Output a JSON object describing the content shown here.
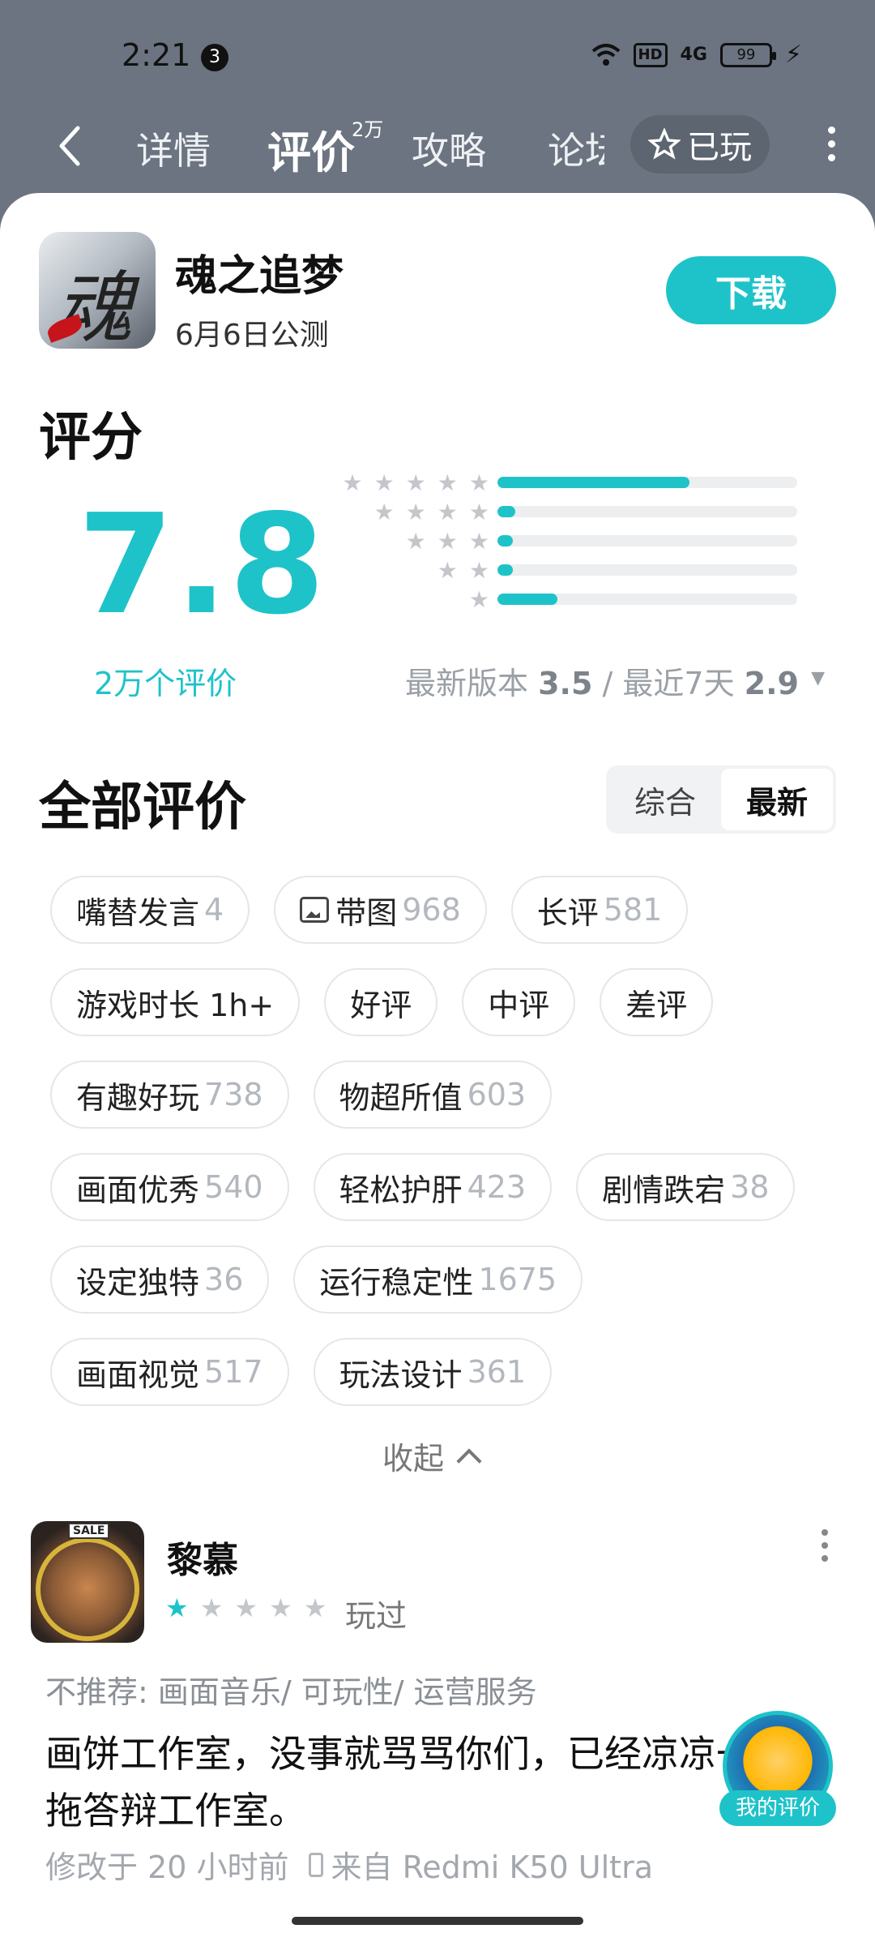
{
  "status_bar": {
    "time": "2:21",
    "notification_count": "3",
    "hd": "HD",
    "network": "4G",
    "battery": "99"
  },
  "nav": {
    "tabs": [
      {
        "label": "详情"
      },
      {
        "label": "评价",
        "badge": "2万"
      },
      {
        "label": "攻略"
      },
      {
        "label": "论坛"
      }
    ],
    "played_label": "已玩"
  },
  "game": {
    "name": "魂之追梦",
    "subtitle": "6月6日公测",
    "download_label": "下载"
  },
  "score": {
    "section_title": "评分",
    "value": "7.8",
    "count": "2万个评价",
    "distribution": [
      {
        "stars": 5,
        "fraction": 0.64
      },
      {
        "stars": 4,
        "fraction": 0.06
      },
      {
        "stars": 3,
        "fraction": 0.05
      },
      {
        "stars": 2,
        "fraction": 0.05
      },
      {
        "stars": 1,
        "fraction": 0.2
      }
    ],
    "latest_version_label": "最新版本",
    "latest_version_score": "3.5",
    "separator": "/",
    "recent_label": "最近7天",
    "recent_score": "2.9"
  },
  "all_reviews": {
    "title": "全部评价",
    "sort_options": [
      "综合",
      "最新"
    ],
    "selected_sort": "最新",
    "tag_rows": [
      [
        {
          "label": "嘴替发言",
          "count": "4"
        },
        {
          "label": "带图",
          "count": "968",
          "icon": "image-icon"
        },
        {
          "label": "长评",
          "count": "581"
        }
      ],
      [
        {
          "label": "游戏时长 1h+",
          "count": ""
        },
        {
          "label": "好评",
          "count": ""
        },
        {
          "label": "中评",
          "count": ""
        },
        {
          "label": "差评",
          "count": ""
        }
      ],
      [
        {
          "label": "有趣好玩",
          "count": "738"
        },
        {
          "label": "物超所值",
          "count": "603"
        }
      ],
      [
        {
          "label": "画面优秀",
          "count": "540"
        },
        {
          "label": "轻松护肝",
          "count": "423"
        },
        {
          "label": "剧情跌宕",
          "count": "38"
        }
      ],
      [
        {
          "label": "设定独特",
          "count": "36"
        },
        {
          "label": "运行稳定性",
          "count": "1675"
        }
      ],
      [
        {
          "label": "画面视觉",
          "count": "517"
        },
        {
          "label": "玩法设计",
          "count": "361"
        }
      ]
    ],
    "collapse_label": "收起"
  },
  "review": {
    "username": "黎慕",
    "rating": 1,
    "max_rating": 5,
    "status": "玩过",
    "not_recommend": "不推荐: 画面音乐/ 可玩性/ 运营服务",
    "text": "画饼工作室，没事就骂骂你们，已经凉凉一拖答辩工作室。",
    "modified": "修改于 20 小时前",
    "device": "来自 Redmi K50 Ultra",
    "avatar_badge": "SALE"
  },
  "my_review_label": "我的评价",
  "colors": {
    "accent": "#1ec3c9",
    "header_bg": "#6b7480"
  }
}
